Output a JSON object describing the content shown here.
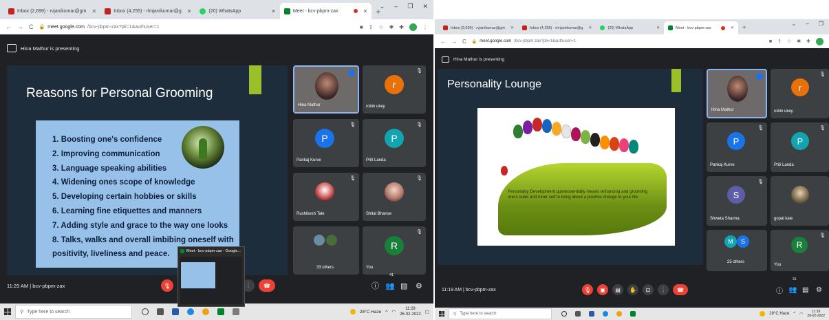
{
  "left": {
    "tabs": [
      {
        "label": "Inbox (2,699) - rvjanikumar@gm",
        "favicon": "#c5221f"
      },
      {
        "label": "Inbox (4,255) - rlmjanikumar@g",
        "favicon": "#c5221f"
      },
      {
        "label": "(20) WhatsApp",
        "favicon": "#25d366"
      },
      {
        "label": "Meet - bcv-pbpm-zax",
        "favicon": "#00832d",
        "active": true
      }
    ],
    "url_host": "meet.google.com",
    "url_path": "/bcv-pbpm-zax?pli=1&authuser=1",
    "presenting": "Hina Mathur is presenting",
    "slide_title": "Reasons for Personal Grooming",
    "slide_items": [
      "1.  Boosting one's confidence",
      "2.  Improving communication",
      "3.  Language speaking abilities",
      "4.  Widening ones scope of knowledge",
      "5.  Developing certain hobbies or skills",
      "6.  Learning fine etiquettes and manners",
      "7.  Adding style and grace to the way one looks",
      "8.  Talks, walks and overall imbibing oneself with",
      "     positivity, liveliness and peace."
    ],
    "participants": {
      "hina": "Hina Mathur",
      "robin": "robin ukey",
      "robin_initial": "r",
      "pankaj": "Pankaj Kurve",
      "pankaj_initial": "P",
      "priti": "Priti Landa",
      "priti_initial": "P",
      "rushikesh": "Rushikesh Tale",
      "shital": "Shital Bhanse",
      "others": "33 others",
      "you": "You",
      "you_initial": "R"
    },
    "meeting": "11:29 AM  |  bcv-pbpm-zax",
    "popup_title": "Meet - bcv-pbpm-zax - Google...",
    "badge_count": "41",
    "taskbar": {
      "search_placeholder": "Type here to search",
      "weather": "28°C  Haze",
      "time": "11:29",
      "date": "26-02-2022"
    }
  },
  "right": {
    "tabs": [
      {
        "label": "Inbox (2,699) - rvjanikumar@gm",
        "favicon": "#c5221f"
      },
      {
        "label": "Inbox (4,255) - rlmjanikumar@g",
        "favicon": "#c5221f"
      },
      {
        "label": "(20) WhatsApp",
        "favicon": "#25d366"
      },
      {
        "label": "Meet - bcv-pbpm-zax",
        "favicon": "#00832d",
        "active": true
      }
    ],
    "url_host": "meet.google.com",
    "url_path": "/bcv-pbpm-zax?pli=1&authuser=1",
    "presenting": "Hina Mathur is presenting",
    "slide_title": "Personality Lounge",
    "slide_text": "Personality Development quintessentially means enhancing and  grooming one's outer and inner self to bring about a positive change to your life.",
    "participants": {
      "hina": "Hina Mathur",
      "robin": "robin ukey",
      "robin_initial": "r",
      "pankaj": "Pankaj Kurve",
      "pankaj_initial": "P",
      "priti": "Priti Landa",
      "priti_initial": "P",
      "shweta": "Shweta Sharma",
      "shweta_initial": "S",
      "gopal": "gopal kale",
      "others": "25 others",
      "others_m": "M",
      "others_s": "S",
      "you": "You",
      "you_initial": "R"
    },
    "meeting": "11:19 AM  |  bcv-pbpm-zax",
    "badge_count": "31",
    "taskbar": {
      "search_placeholder": "Type here to search",
      "weather": "28°C  Haze",
      "time": "11:19",
      "date": "26-02-2022"
    }
  },
  "colors": {
    "meet_bg": "#202124",
    "tile_bg": "#3c4043",
    "accent_green": "#9bbf2a",
    "slide_navy": "#1e2d3c",
    "box_blue": "#98c1ea",
    "red": "#ea4335",
    "avatar_orange": "#e8710a",
    "avatar_blue": "#1a73e8",
    "avatar_teal": "#12a4af",
    "avatar_purple": "#5e5ea8",
    "avatar_green": "#188038"
  }
}
